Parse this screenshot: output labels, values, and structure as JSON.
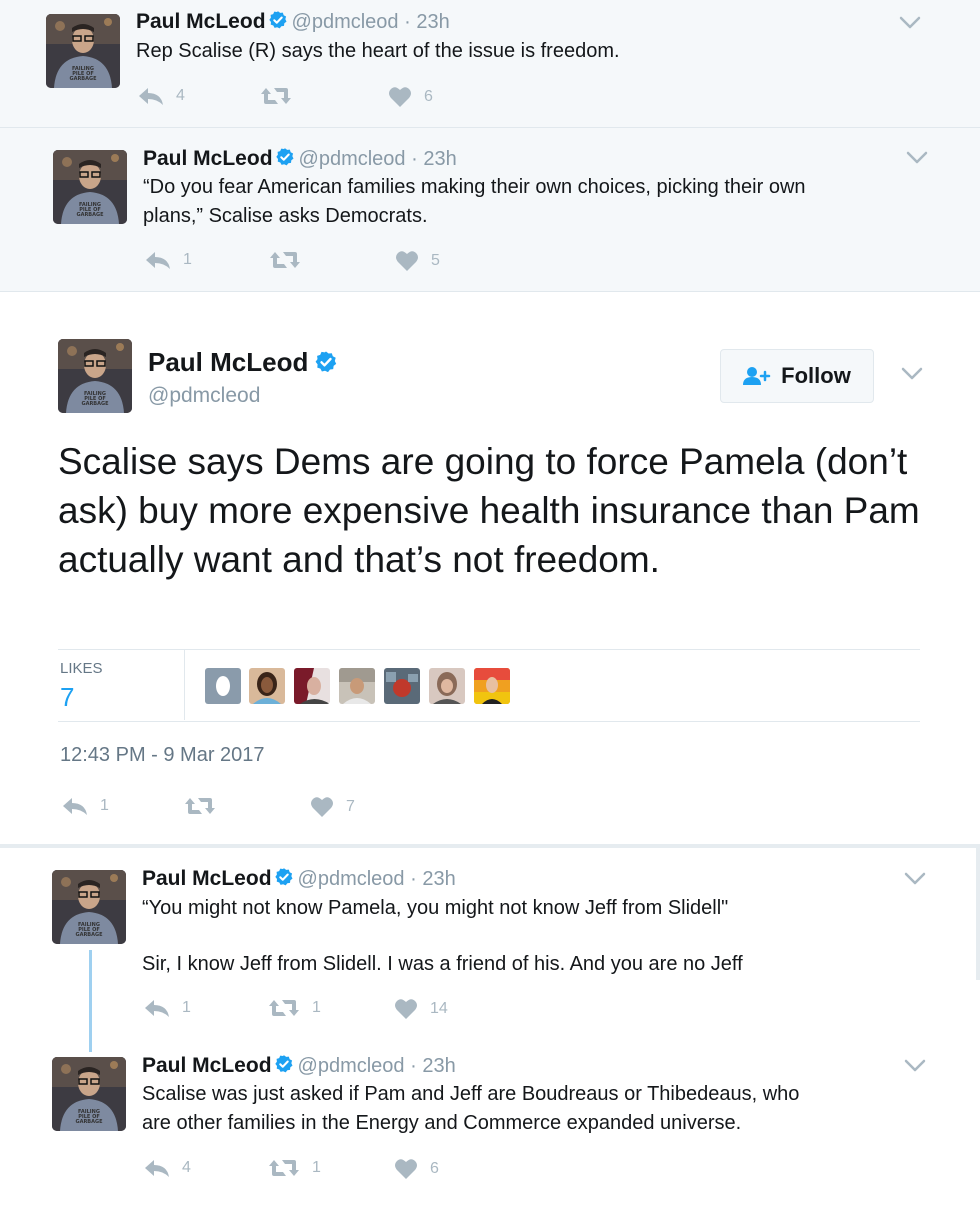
{
  "colors": {
    "accent": "#1da1f2",
    "verified": "#1da1f2",
    "muted": "#8899a6",
    "grey_bg": "#f5f8fa",
    "thread_line": "#9fd0f0"
  },
  "tweets_above": [
    {
      "name": "Paul McLeod",
      "handle": "@pdmcleod · 23h",
      "lines": [
        "Rep Scalise (R) says the heart of the issue is freedom."
      ],
      "replies": "4",
      "retweets": "",
      "likes": "6"
    },
    {
      "name": "Paul McLeod",
      "handle": "@pdmcleod · 23h",
      "lines": [
        "“Do you fear American families making their own choices, picking their own",
        "plans,” Scalise asks Democrats."
      ],
      "replies": "1",
      "retweets": "",
      "likes": "5"
    }
  ],
  "main_tweet": {
    "name": "Paul McLeod",
    "handle": "@pdmcleod",
    "follow_label": "Follow",
    "text": "Scalise says Dems are going to force Pamela (don’t ask) buy more expensive health insurance than Pam actually want and that’s not freedom.",
    "likes_label": "LIKES",
    "likes_count": "7",
    "timestamp": "12:43 PM - 9 Mar 2017",
    "replies": "1",
    "retweets": "",
    "likes": "7"
  },
  "tweets_below": [
    {
      "name": "Paul McLeod",
      "handle": "@pdmcleod · 23h",
      "lines": [
        "“You might not know Pamela, you might not know Jeff from Slidell\""
      ],
      "lines2": [
        "Sir, I know Jeff from Slidell. I was a friend of his. And you are no Jeff"
      ],
      "replies": "1",
      "retweets": "1",
      "likes": "14"
    },
    {
      "name": "Paul McLeod",
      "handle": "@pdmcleod · 23h",
      "lines": [
        "Scalise was just asked if Pam and Jeff are Boudreaus or Thibedeaus, who",
        "are other families in the Energy and Commerce expanded universe."
      ],
      "replies": "4",
      "retweets": "1",
      "likes": "6"
    }
  ]
}
